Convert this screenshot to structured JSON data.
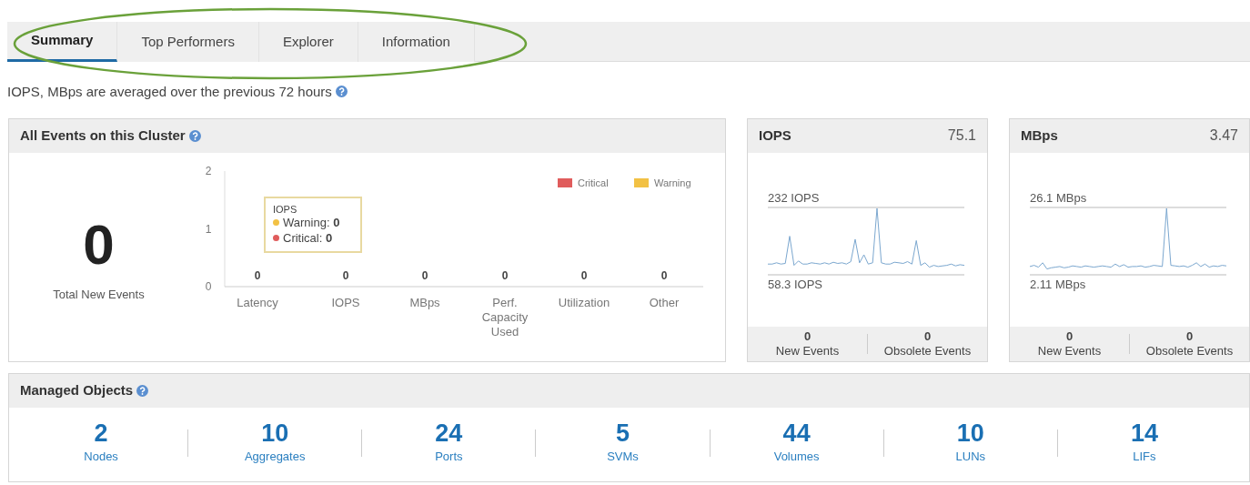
{
  "tabs": [
    {
      "label": "Summary",
      "selected": true
    },
    {
      "label": "Top Performers",
      "selected": false
    },
    {
      "label": "Explorer",
      "selected": false
    },
    {
      "label": "Information",
      "selected": false
    }
  ],
  "note": "IOPS, MBps are averaged over the previous 72 hours",
  "events_panel": {
    "title": "All Events on this Cluster",
    "total": "0",
    "total_label": "Total New Events",
    "chart_data": {
      "type": "bar",
      "stacked": true,
      "categories": [
        "Latency",
        "IOPS",
        "MBps",
        "Perf. Capacity Used",
        "Utilization",
        "Other"
      ],
      "series": [
        {
          "name": "Critical",
          "color": "#e05c5c",
          "values": [
            0,
            0,
            0,
            0,
            0,
            0
          ],
          "value_labels": [
            "0",
            "0",
            "0",
            "0",
            "0",
            "0"
          ]
        },
        {
          "name": "Warning",
          "color": "#f2c144",
          "values": [
            0,
            0,
            0,
            0,
            0,
            0
          ],
          "value_labels": [
            null,
            null,
            null,
            null,
            null,
            null
          ]
        }
      ],
      "ylim": [
        0,
        2
      ],
      "yticks": [
        0,
        1,
        2
      ]
    },
    "tooltip": {
      "title": "IOPS",
      "rows": [
        {
          "label": "Warning:",
          "value": "0",
          "color": "#f2c144"
        },
        {
          "label": "Critical:",
          "value": "0",
          "color": "#e05c5c"
        }
      ]
    }
  },
  "metric_panels": [
    {
      "title": "IOPS",
      "value": "75.1",
      "max_label": "232 IOPS",
      "min_label": "58.3 IOPS",
      "new_events": "0",
      "new_events_label": "New Events",
      "obsolete_events": "0",
      "obsolete_events_label": "Obsolete Events"
    },
    {
      "title": "MBps",
      "value": "3.47",
      "max_label": "26.1 MBps",
      "min_label": "2.11 MBps",
      "new_events": "0",
      "new_events_label": "New Events",
      "obsolete_events": "0",
      "obsolete_events_label": "Obsolete Events"
    }
  ],
  "managed_objects": {
    "title": "Managed Objects",
    "items": [
      {
        "count": "2",
        "label": "Nodes"
      },
      {
        "count": "10",
        "label": "Aggregates"
      },
      {
        "count": "24",
        "label": "Ports"
      },
      {
        "count": "5",
        "label": "SVMs"
      },
      {
        "count": "44",
        "label": "Volumes"
      },
      {
        "count": "10",
        "label": "LUNs"
      },
      {
        "count": "14",
        "label": "LIFs"
      }
    ]
  }
}
